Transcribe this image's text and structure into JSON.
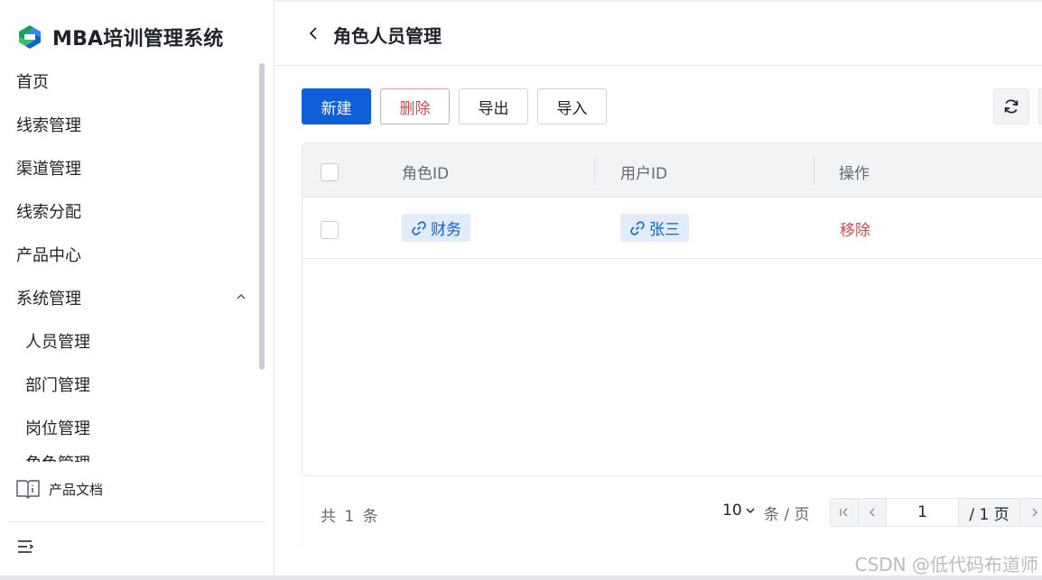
{
  "app": {
    "title": "MBA培训管理系统"
  },
  "sidebar": {
    "items": [
      {
        "label": "首页"
      },
      {
        "label": "线索管理"
      },
      {
        "label": "渠道管理"
      },
      {
        "label": "线索分配"
      },
      {
        "label": "产品中心"
      },
      {
        "label": "系统管理"
      },
      {
        "label": "人员管理"
      },
      {
        "label": "部门管理"
      },
      {
        "label": "岗位管理"
      },
      {
        "label": "角色管理"
      }
    ],
    "docs_label": "产品文档"
  },
  "header": {
    "title": "角色人员管理"
  },
  "toolbar": {
    "new_label": "新建",
    "delete_label": "删除",
    "export_label": "导出",
    "import_label": "导入"
  },
  "table": {
    "columns": [
      "角色ID",
      "用户ID",
      "操作"
    ],
    "rows": [
      {
        "role": "财务",
        "user": "张三",
        "action": "移除"
      }
    ]
  },
  "pagination": {
    "total_label": "共 1 条",
    "page_size": "10",
    "per_page_label": "条 / 页",
    "current_page": "1",
    "total_pages_label": "/ 1 页"
  },
  "watermark": "CSDN @低代码布道师",
  "colors": {
    "primary": "#0e5fd8",
    "danger": "#d4494f",
    "tag_bg": "#e1ecfb"
  }
}
